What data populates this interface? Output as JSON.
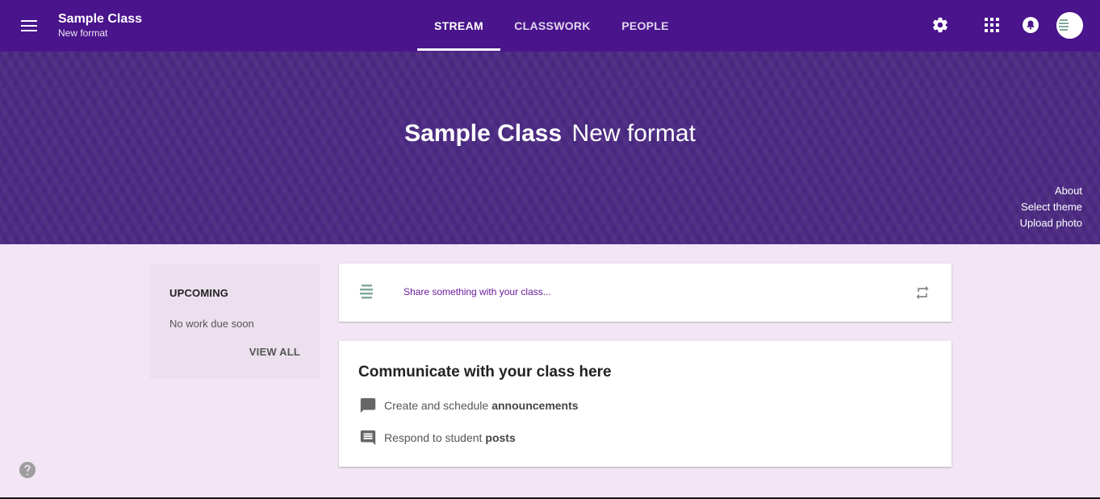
{
  "header": {
    "class_name": "Sample Class",
    "class_section": "New format",
    "tabs": [
      {
        "label": "STREAM",
        "active": true
      },
      {
        "label": "CLASSWORK",
        "active": false
      },
      {
        "label": "PEOPLE",
        "active": false
      }
    ],
    "icons": [
      "menu-icon",
      "settings-icon",
      "apps-grid-icon",
      "notifications-icon",
      "account-avatar"
    ]
  },
  "banner": {
    "title": "Sample Class",
    "section": "New format",
    "links": {
      "about": "About",
      "select_theme": "Select theme",
      "upload_photo": "Upload photo"
    }
  },
  "upcoming": {
    "title": "UPCOMING",
    "empty_text": "No work due soon",
    "view_all": "VIEW ALL"
  },
  "share": {
    "placeholder": "Share something with your class..."
  },
  "communicate": {
    "title": "Communicate with your class here",
    "rows": [
      {
        "text": "Create and schedule",
        "bold": "announcements",
        "icon": "announcement-icon"
      },
      {
        "text": "Respond to student",
        "bold": "posts",
        "icon": "comment-icon"
      }
    ]
  },
  "colors": {
    "primary": "#4a148c",
    "banner": "#4d2a84",
    "page_background": "#f3e5f5",
    "accent_text": "#6a1b9a"
  }
}
